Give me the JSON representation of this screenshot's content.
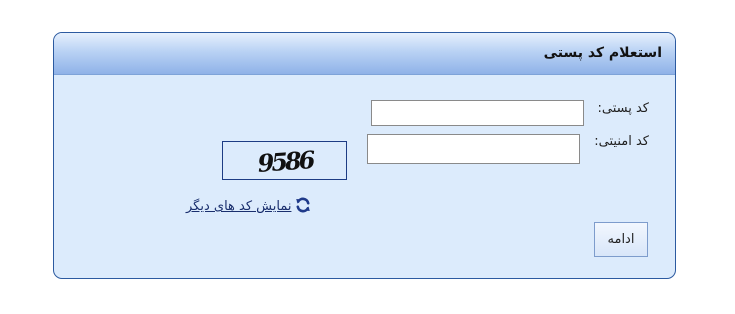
{
  "panel": {
    "title": "استعلام کد پستی"
  },
  "form": {
    "postal_code_label": "کد پستی:",
    "postal_code_value": "",
    "security_code_label": "کد امنیتی:",
    "security_code_value": ""
  },
  "captcha": {
    "text": "9586"
  },
  "refresh": {
    "label": "نمایش کد های دیگر",
    "icon": "refresh-icon"
  },
  "actions": {
    "continue_label": "ادامه"
  },
  "colors": {
    "panel_background": "#dcebfc",
    "panel_border": "#2c5aa0",
    "header_gradient_top": "#e6f0fd",
    "header_gradient_bottom": "#8fb2e8",
    "link": "#1a2f6e",
    "refresh_icon": "#1f3a8a"
  }
}
